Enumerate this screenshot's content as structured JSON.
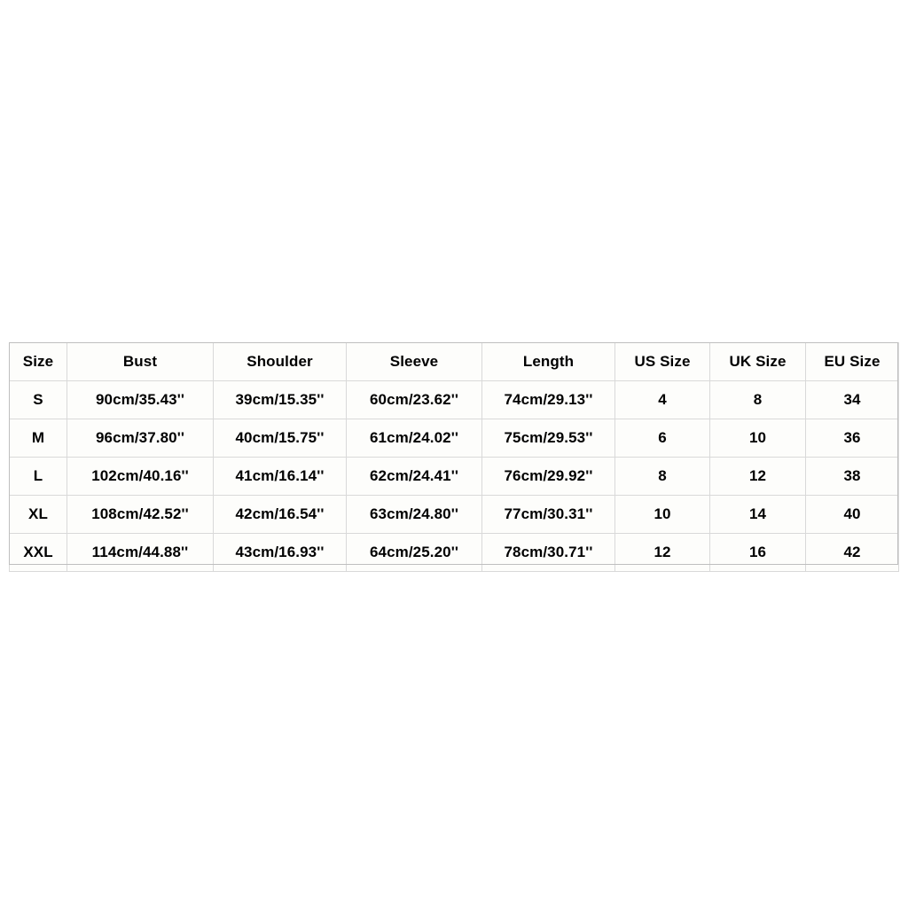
{
  "page": {
    "background_color": "#ffffff",
    "table_border_color": "#d9d9d9",
    "text_color": "#000000",
    "cell_background": "#fdfdfb"
  },
  "size_chart": {
    "columns": [
      "Size",
      "Bust",
      "Shoulder",
      "Sleeve",
      "Length",
      "US Size",
      "UK Size",
      "EU Size"
    ],
    "rows": [
      {
        "size": "S",
        "bust": "90cm/35.43''",
        "shoulder": "39cm/15.35''",
        "sleeve": "60cm/23.62''",
        "length": "74cm/29.13''",
        "us_size": "4",
        "uk_size": "8",
        "eu_size": "34"
      },
      {
        "size": "M",
        "bust": "96cm/37.80''",
        "shoulder": "40cm/15.75''",
        "sleeve": "61cm/24.02''",
        "length": "75cm/29.53''",
        "us_size": "6",
        "uk_size": "10",
        "eu_size": "36"
      },
      {
        "size": "L",
        "bust": "102cm/40.16''",
        "shoulder": "41cm/16.14''",
        "sleeve": "62cm/24.41''",
        "length": "76cm/29.92''",
        "us_size": "8",
        "uk_size": "12",
        "eu_size": "38"
      },
      {
        "size": "XL",
        "bust": "108cm/42.52''",
        "shoulder": "42cm/16.54''",
        "sleeve": "63cm/24.80''",
        "length": "77cm/30.31''",
        "us_size": "10",
        "uk_size": "14",
        "eu_size": "40"
      },
      {
        "size": "XXL",
        "bust": "114cm/44.88''",
        "shoulder": "43cm/16.93''",
        "sleeve": "64cm/25.20''",
        "length": "78cm/30.71''",
        "us_size": "12",
        "uk_size": "16",
        "eu_size": "42"
      }
    ]
  }
}
